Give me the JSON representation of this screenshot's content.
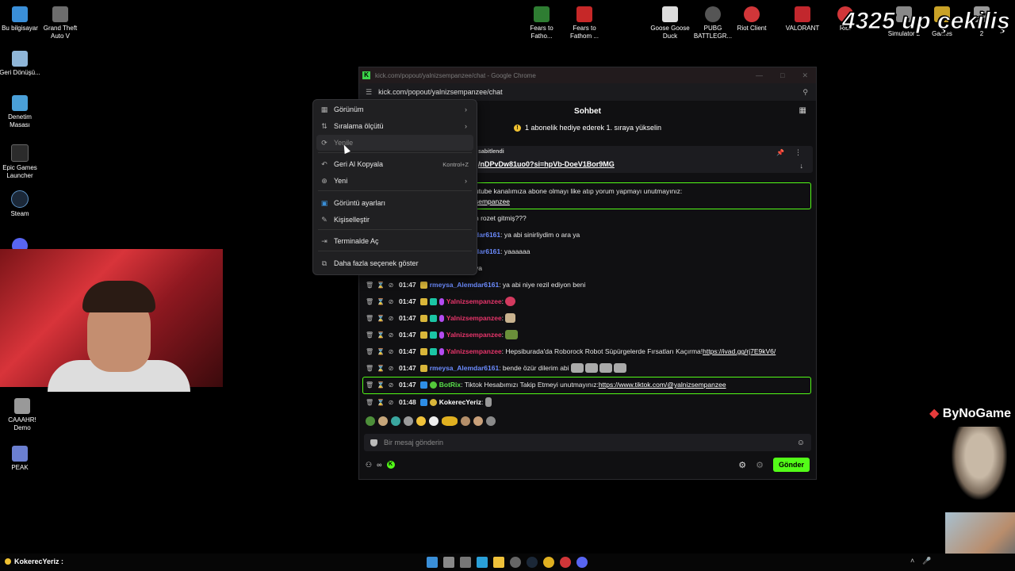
{
  "desktop": {
    "icons_left": [
      {
        "label": "Bu bilgisayar",
        "color": "#3a8fd8"
      },
      {
        "label": "Grand Theft Auto V",
        "color": "#6d6d6d"
      },
      {
        "label": "Geri Dönüşü...",
        "color": "#8fb6d8"
      },
      {
        "label": "Denetim Masası",
        "color": "#4aa0d8"
      },
      {
        "label": "Epic Games Launcher",
        "color": "#2b2b2b"
      },
      {
        "label": "Steam",
        "color": "#1b2838"
      },
      {
        "label": "CAAAHR! Demo",
        "color": "#999999"
      },
      {
        "label": "PEAK",
        "color": "#6b7fd0"
      }
    ],
    "icons_top": [
      {
        "label": "Fears to Fatho...",
        "color": "#2e7d32"
      },
      {
        "label": "Fears to Fathom ...",
        "color": "#c62828"
      },
      {
        "label": "Goose Goose Duck",
        "color": "#dddddd"
      },
      {
        "label": "PUBG BATTLEGR...",
        "color": "#555555"
      },
      {
        "label": "Riot Client",
        "color": "#d13639"
      },
      {
        "label": "VALORANT",
        "color": "#c2272d"
      },
      {
        "label": "Riot",
        "color": "#d13639"
      },
      {
        "label": "Simulator 2",
        "color": "#888888"
      },
      {
        "label": "Games",
        "color": "#c9a227"
      },
      {
        "label": "2",
        "color": "#999999"
      }
    ]
  },
  "overlay": {
    "title": "4325 up çekiliş",
    "sponsor": "ByNoGame"
  },
  "browser": {
    "window_title": "kick.com/popout/yalnizsempanzee/chat - Google Chrome",
    "url": "kick.com/popout/yalnizsempanzee/chat",
    "chat_header": "Sohbet",
    "promo": "1 abonelik hediye ederek 1. sıraya yükselin",
    "pinned": {
      "label": "sabitlendi",
      "link": "/nDPvDw81uo0?si=hpVb-DoeV1Bor9MG"
    },
    "highlight_msg": {
      "line1": "utube kanalımıza abone olmayı like atıp yorum yapmayı unutmayınız:",
      "line2": "sempanzee"
    },
    "messages": [
      {
        "text": "n rozet gitmiş???"
      },
      {
        "user": "dar6161",
        "text": ": ya abi sinirliydim o ara ya"
      },
      {
        "user": "dar6161",
        "text": ": yaaaaaa"
      },
      {
        "text": "ya"
      },
      {
        "time": "01:47",
        "user": "rmeysa_Alemdar6161",
        "text": ": ya abi niye rezil ediyon beni"
      },
      {
        "time": "01:47",
        "user": "Yalnizsempanzee",
        "text": ":"
      },
      {
        "time": "01:47",
        "user": "Yalnizsempanzee",
        "text": ":"
      },
      {
        "time": "01:47",
        "user": "Yalnizsempanzee",
        "text": ":"
      },
      {
        "time": "01:47",
        "user": "Yalnizsempanzee",
        "text": ": Hepsiburada'da Roborock Robot Süpürgelerde Fırsatları Kaçırma! ",
        "link": "https://ivad.gg/rj7E9kV6/"
      },
      {
        "time": "01:47",
        "user": "rmeysa_Alemdar6161",
        "text": ": bende özür dilerim abi"
      },
      {
        "time": "01:47",
        "user": "BotRix",
        "text": ": Tiktok Hesabımızı Takip Etmeyi unutmayınız: ",
        "link": "https://www.tiktok.com/@yalnizsempanzee"
      },
      {
        "time": "01:48",
        "user": "KokerecYeriz",
        "text": ":"
      }
    ],
    "input_placeholder": "Bir mesaj gönderin",
    "send_label": "Gönder"
  },
  "context_menu": {
    "items": [
      {
        "label": "Görünüm",
        "icon": "grid-icon",
        "submenu": true
      },
      {
        "label": "Sıralama ölçütü",
        "icon": "sort-icon",
        "submenu": true
      },
      {
        "label": "Yenile",
        "icon": "refresh-icon"
      },
      {
        "label": "Geri Al Kopyala",
        "icon": "undo-icon",
        "shortcut": "Kontrol+Z"
      },
      {
        "label": "Yeni",
        "icon": "plus-circle-icon",
        "submenu": true
      },
      {
        "label": "Görüntü ayarları",
        "icon": "display-icon"
      },
      {
        "label": "Kişiselleştir",
        "icon": "pen-icon"
      },
      {
        "label": "Terminalde Aç",
        "icon": "terminal-icon"
      },
      {
        "label": "Daha fazla seçenek göster",
        "icon": "more-options-icon"
      }
    ]
  },
  "taskbar": {
    "now_playing": "KokerecYeriz :"
  },
  "colors": {
    "kick_green": "#53fc18",
    "user_blue": "#6c8cff",
    "user_red": "#e7356b"
  }
}
